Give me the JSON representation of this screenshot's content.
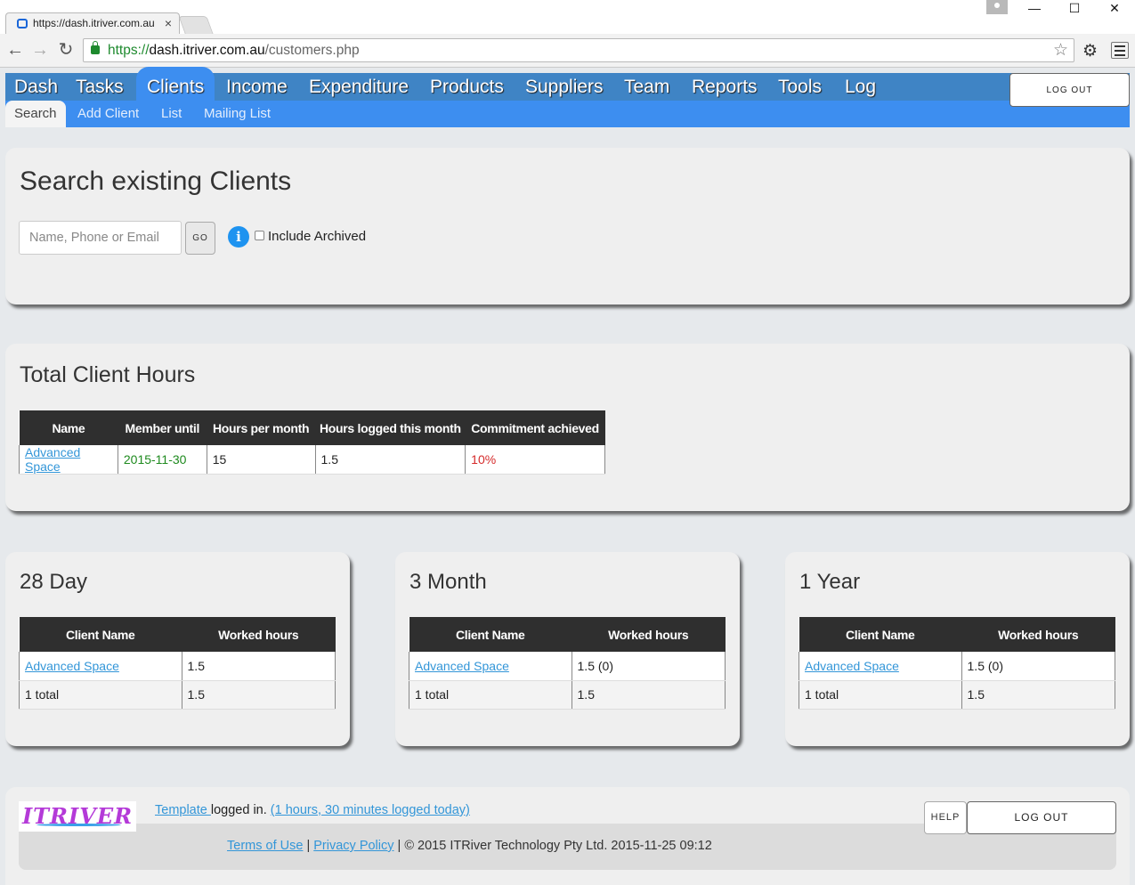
{
  "browser": {
    "tab_title": "https://dash.itriver.com.au",
    "tab_close": "×",
    "url_scheme": "https://",
    "url_host": "dash.itriver.com.au",
    "url_path": "/customers.php",
    "min": "—",
    "max": "☐",
    "close": "✕"
  },
  "nav": {
    "main": [
      "Dash",
      "Tasks",
      "Clients",
      "Income",
      "Expenditure",
      "Products",
      "Suppliers",
      "Team",
      "Reports",
      "Tools",
      "Log"
    ],
    "active_main": "Clients",
    "sub": [
      "Search",
      "Add Client",
      "List",
      "Mailing List"
    ],
    "active_sub": "Search",
    "logout": "LOG OUT"
  },
  "search": {
    "title": "Search existing Clients",
    "placeholder": "Name, Phone or Email",
    "go": "GO",
    "info": "i",
    "archived_label": "Include Archived"
  },
  "hours": {
    "title": "Total Client Hours",
    "columns": [
      "Name",
      "Member until",
      "Hours per month",
      "Hours logged this month",
      "Commitment achieved"
    ],
    "row": {
      "name": "Advanced Space",
      "member_until": "2015-11-30",
      "hours_per_month": "15",
      "hours_logged": "1.5",
      "commitment": "10%"
    }
  },
  "periods": [
    {
      "title": "28 Day",
      "col_client": "Client Name",
      "col_hours": "Worked hours",
      "client": "Advanced Space",
      "hours": "1.5",
      "total_label": "1 total",
      "total_hours": "1.5"
    },
    {
      "title": "3 Month",
      "col_client": "Client Name",
      "col_hours": "Worked hours",
      "client": "Advanced Space",
      "hours": "1.5 (0)",
      "total_label": "1 total",
      "total_hours": "1.5"
    },
    {
      "title": "1 Year",
      "col_client": "Client Name",
      "col_hours": "Worked hours",
      "client": "Advanced Space",
      "hours": "1.5 (0)",
      "total_label": "1 total",
      "total_hours": "1.5"
    }
  ],
  "footer": {
    "logo": "ITRIVER",
    "template_link": "Template ",
    "logged_in": "logged in. ",
    "logged_today": "(1 hours, 30 minutes logged today)",
    "terms": "Terms of Use",
    "sep1": " | ",
    "privacy": "Privacy Policy",
    "copyright": " | © 2015 ITRiver Technology Pty Ltd. 2015-11-25 09:12",
    "help": "HELP",
    "logout": "LOG OUT"
  },
  "colors": {
    "nav_bar": "#3f84c5",
    "sub_bar": "#3d8ef0",
    "table_header": "#2f2f2f",
    "link": "#3396d8",
    "date_green": "#1e8a1e",
    "commit_red": "#d52b2b"
  }
}
